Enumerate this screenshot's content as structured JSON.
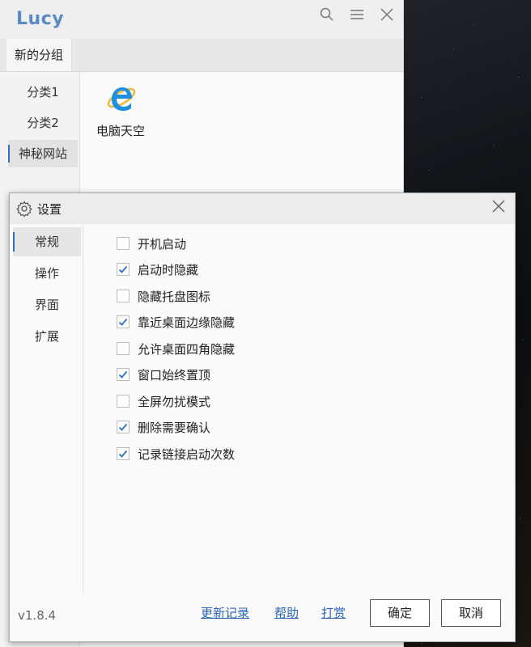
{
  "main_window": {
    "app_title": "Lucy",
    "titlebar_icons": [
      "search-icon",
      "menu-icon",
      "close-icon"
    ],
    "group_tab": "新的分组",
    "categories": [
      {
        "label": "分类1",
        "active": false
      },
      {
        "label": "分类2",
        "active": false
      },
      {
        "label": "神秘网站",
        "active": true
      }
    ],
    "links": [
      {
        "label": "电脑天空",
        "icon": "ie-icon"
      }
    ]
  },
  "settings": {
    "title": "设置",
    "nav": [
      {
        "label": "常规",
        "active": true
      },
      {
        "label": "操作",
        "active": false
      },
      {
        "label": "界面",
        "active": false
      },
      {
        "label": "扩展",
        "active": false
      }
    ],
    "options": [
      {
        "label": "开机启动",
        "checked": false
      },
      {
        "label": "启动时隐藏",
        "checked": true
      },
      {
        "label": "隐藏托盘图标",
        "checked": false
      },
      {
        "label": "靠近桌面边缘隐藏",
        "checked": true
      },
      {
        "label": "允许桌面四角隐藏",
        "checked": false
      },
      {
        "label": "窗口始终置顶",
        "checked": true
      },
      {
        "label": "全屏勿扰模式",
        "checked": false
      },
      {
        "label": "删除需要确认",
        "checked": true
      },
      {
        "label": "记录链接启动次数",
        "checked": true
      }
    ],
    "footer": {
      "version": "v1.8.4",
      "changelog": "更新记录",
      "help": "帮助",
      "donate": "打赏",
      "ok": "确定",
      "cancel": "取消"
    }
  },
  "colors": {
    "accent": "#2d6fc0",
    "title": "#5b8ac2",
    "link": "#2b64b4",
    "check": "#2f6fc4"
  }
}
